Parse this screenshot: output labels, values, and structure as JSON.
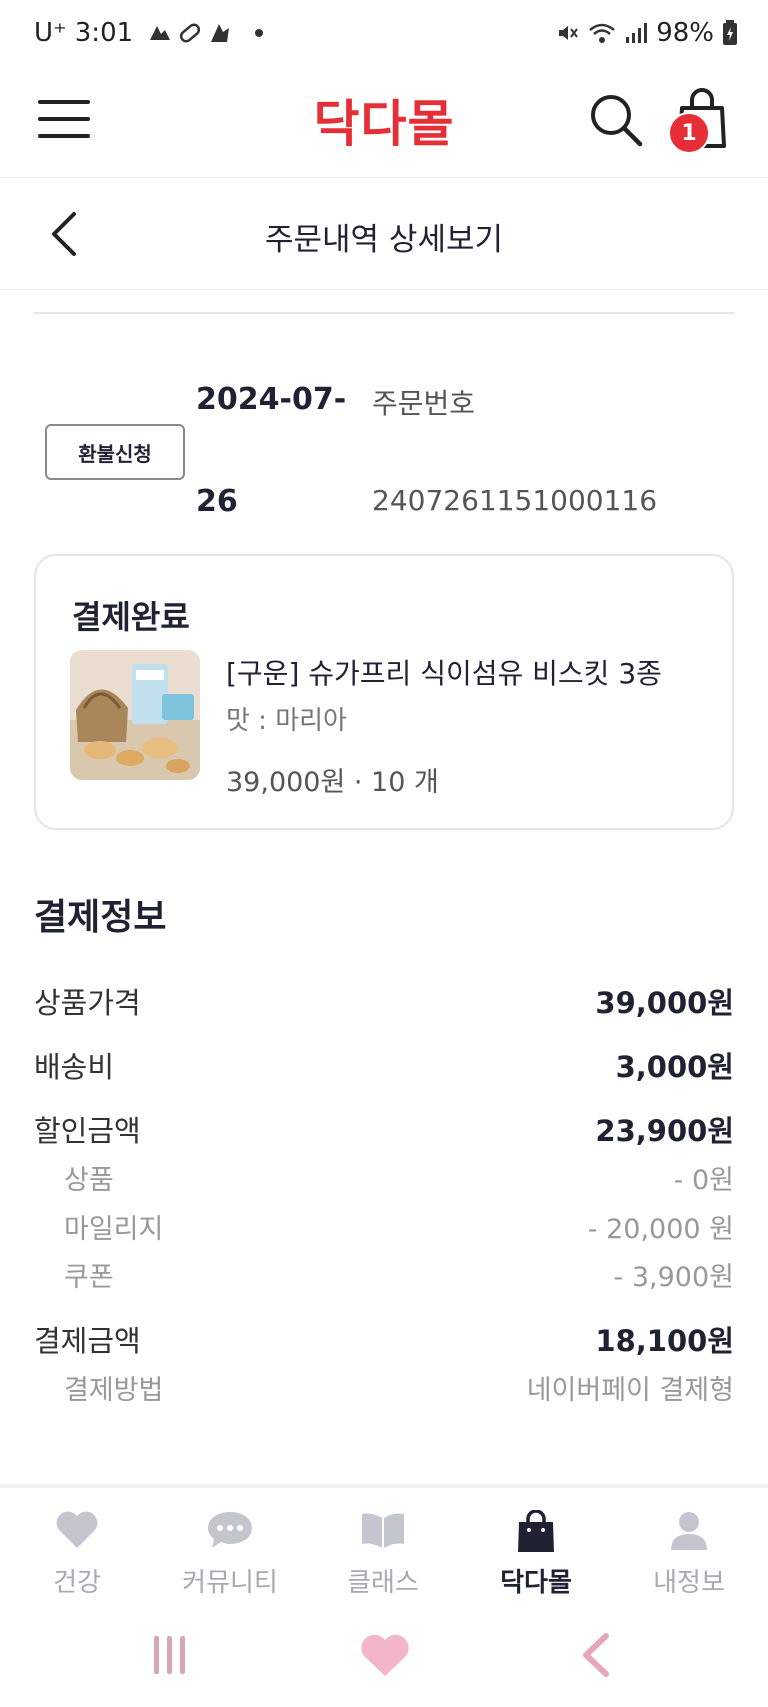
{
  "status_bar": {
    "carrier": "U⁺",
    "time": "3:01",
    "battery": "98%"
  },
  "header": {
    "brand": "닥다몰",
    "cart_count": "1"
  },
  "sub_header": {
    "title": "주문내역 상세보기"
  },
  "order": {
    "refund_label": "환불신청",
    "date_line1": "2024-07-",
    "date_line2": "26",
    "order_number_label": "주문번호",
    "order_number": "2407261151000116"
  },
  "order_card": {
    "status": "결제완료",
    "product_name": "[구운] 슈가프리 식이섬유 비스킷 3종",
    "option": "맛 : 마리아",
    "price_qty": "39,000원 · 10 개"
  },
  "payment": {
    "title": "결제정보",
    "rows": [
      {
        "label": "상품가격",
        "value": "39,000원"
      },
      {
        "label": "배송비",
        "value": "3,000원"
      },
      {
        "label": "할인금액",
        "value": "23,900원"
      },
      {
        "label": "상품",
        "value": "- 0원"
      },
      {
        "label": "마일리지",
        "value": "- 20,000 원"
      },
      {
        "label": "쿠폰",
        "value": "- 3,900원"
      },
      {
        "label": "결제금액",
        "value": "18,100원"
      },
      {
        "label": "결제방법",
        "value": "네이버페이 결제형"
      }
    ]
  },
  "bottom_nav": {
    "items": [
      {
        "label": "건강",
        "icon": "heart-icon"
      },
      {
        "label": "커뮤니티",
        "icon": "chat-bubble-icon"
      },
      {
        "label": "클래스",
        "icon": "book-icon"
      },
      {
        "label": "닥다몰",
        "icon": "shopping-bag-icon"
      },
      {
        "label": "내정보",
        "icon": "person-icon"
      }
    ],
    "active_index": 3
  },
  "colors": {
    "brand": "#e62e36",
    "text_dark": "#1f2233",
    "inactive": "#a7a9b3"
  }
}
